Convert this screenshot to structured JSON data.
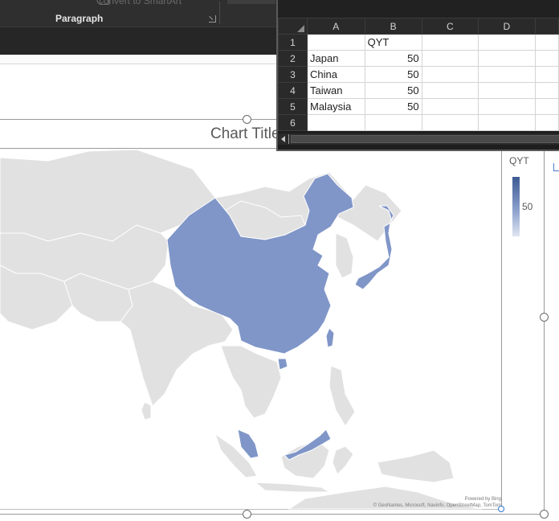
{
  "ribbon": {
    "ghost_command": "Convert to SmartArt",
    "group_label": "Paragraph"
  },
  "spreadsheet": {
    "columns": [
      "A",
      "B",
      "C",
      "D"
    ],
    "rows": [
      {
        "num": "1",
        "a": "",
        "b": "QYT"
      },
      {
        "num": "2",
        "a": "Japan",
        "b": "50"
      },
      {
        "num": "3",
        "a": "China",
        "b": "50"
      },
      {
        "num": "4",
        "a": "Taiwan",
        "b": "50"
      },
      {
        "num": "5",
        "a": "Malaysia",
        "b": "50"
      },
      {
        "num": "6",
        "a": "",
        "b": ""
      }
    ]
  },
  "chart": {
    "title": "Chart Title",
    "legend_title": "QYT",
    "legend_value": "50",
    "attribution_line1": "Powered by Bing",
    "attribution_line2": "© GeoNames, Microsoft, Navinfo, OpenStreetMap, TomTom"
  },
  "chart_data": {
    "type": "map",
    "title": "Chart Title",
    "series": [
      {
        "name": "QYT",
        "values": [
          50,
          50,
          50,
          50
        ]
      }
    ],
    "categories": [
      "Japan",
      "China",
      "Taiwan",
      "Malaysia"
    ],
    "colors": {
      "highlight": "#8096c8",
      "land": "#e1e1e1",
      "border": "#ffffff"
    }
  }
}
